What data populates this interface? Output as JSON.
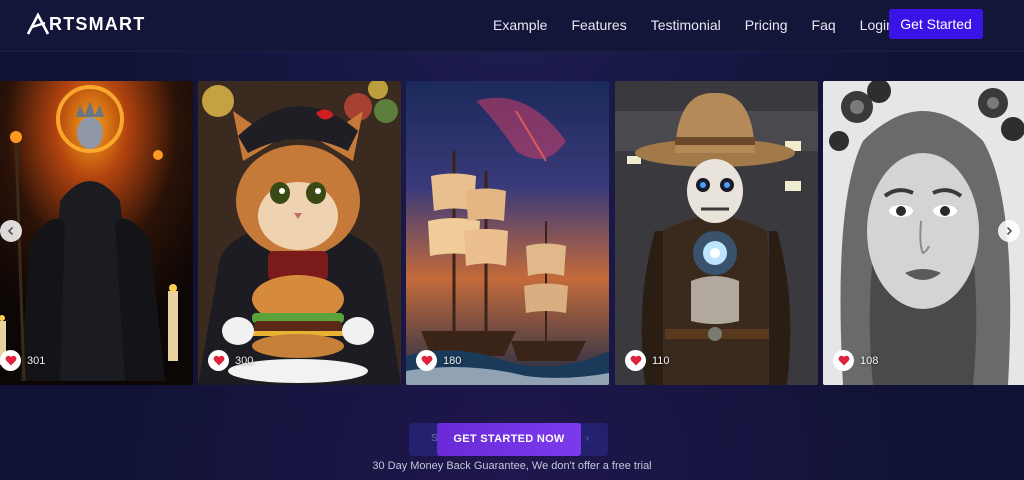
{
  "brand": {
    "name": "RTSMART",
    "mark_letter": "A"
  },
  "nav": {
    "items": [
      "Example",
      "Features",
      "Testimonial",
      "Pricing",
      "Faq",
      "Login"
    ],
    "cta": "Get Started"
  },
  "gallery": {
    "cards": [
      {
        "subject": "dark-king-art",
        "likes": "301"
      },
      {
        "subject": "cat-burger-art",
        "likes": "300"
      },
      {
        "subject": "sailing-ship-art",
        "likes": "180"
      },
      {
        "subject": "skeleton-cowboy-art",
        "likes": "110"
      },
      {
        "subject": "portrait-woman-art",
        "likes": "108"
      }
    ],
    "prev_icon": "chevron-left-icon",
    "next_icon": "chevron-right-icon"
  },
  "cta": {
    "label": "GET STARTED NOW",
    "ghost_left": "S",
    "ghost_right": "›",
    "guarantee": "30 Day Money Back Guarantee, We don't offer a free trial"
  },
  "colors": {
    "background": "#0f1233",
    "primary_button": "#3a14e6",
    "cta_gradient_start": "#6a2ad8",
    "cta_gradient_end": "#7c3aed",
    "heart": "#e0233b"
  }
}
